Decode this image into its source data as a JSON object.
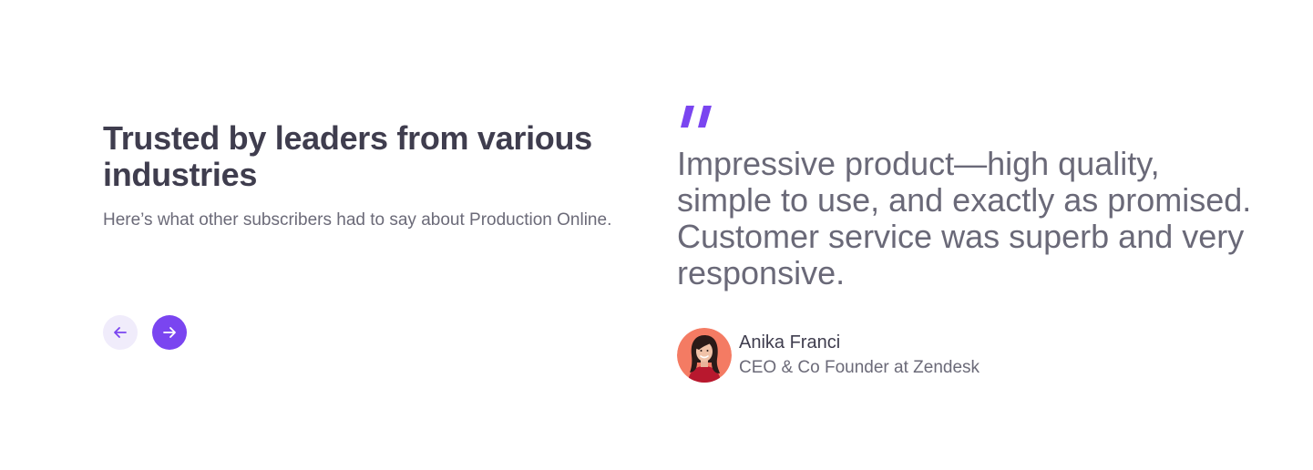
{
  "intro": {
    "heading": "Trusted by leaders from various industries",
    "subtext": "Here’s what other subscribers had to say about Production Online."
  },
  "navigation": {
    "prev_icon": "arrow-left-icon",
    "next_icon": "arrow-right-icon"
  },
  "testimonial": {
    "quote_icon": "quote-icon",
    "quote": "Impressive product—high quality, simple to use, and exactly as promised. Customer service was superb and very responsive.",
    "author_name": "Anika Franci",
    "author_role": "CEO & Co Founder at Zendesk"
  },
  "colors": {
    "accent": "#7a45f0",
    "accent_light": "#f0ecfb",
    "heading": "#3f3d4e",
    "body": "#6b6a78",
    "avatar_bg": "#f47b63"
  }
}
